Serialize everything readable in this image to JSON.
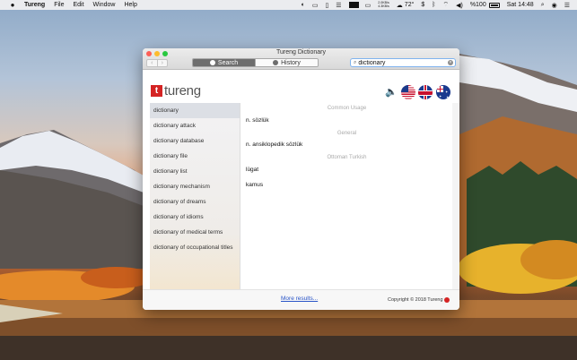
{
  "menubar": {
    "app_name": "Tureng",
    "items": [
      "File",
      "Edit",
      "Window",
      "Help"
    ],
    "status": {
      "net_up": "2.0KB/s",
      "net_down": "4.3KB/s",
      "temperature": "72°",
      "battery": "%100",
      "clock": "Sat 14:48"
    }
  },
  "window": {
    "title": "Tureng Dictionary",
    "tabs": {
      "search": "Search",
      "history": "History"
    },
    "search_value": "dictionary"
  },
  "logo": {
    "word": "tureng"
  },
  "sidebar": {
    "items": [
      "dictionary",
      "dictionary attack",
      "dictionary database",
      "dictionary file",
      "dictionary list",
      "dictionary mechanism",
      "dictionary of dreams",
      "dictionary of idioms",
      "dictionary of medical terms",
      "dictionary of occupational titles"
    ],
    "selected_index": 0
  },
  "results": {
    "sections": [
      {
        "category": "Common Usage",
        "entries": [
          "n. sözlük"
        ]
      },
      {
        "category": "General",
        "entries": [
          "n. ansiklopedik sözlük"
        ]
      },
      {
        "category": "Ottoman Turkish",
        "entries": [
          "lügat",
          "kamus"
        ]
      }
    ]
  },
  "footer": {
    "more_results": "More results...",
    "copyright": "Copyright © 2018 Tureng"
  },
  "colors": {
    "brand_red": "#d42323",
    "link_blue": "#2a55c8",
    "search_focus": "#7fb3ee"
  }
}
